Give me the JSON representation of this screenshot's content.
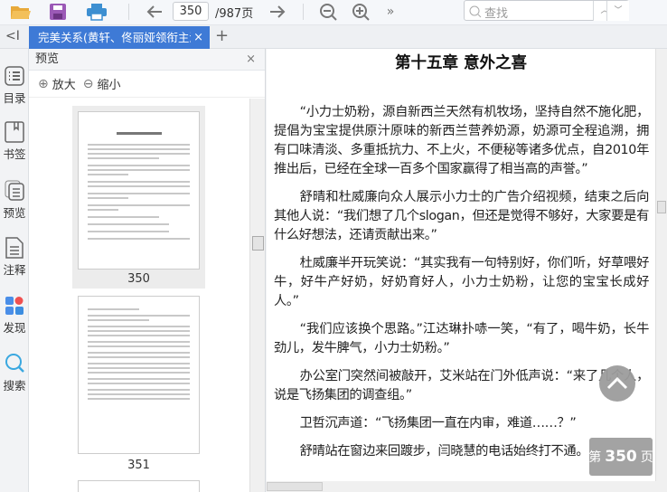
{
  "toolbar": {
    "current_page": "350",
    "total_pages": "/987页",
    "search_placeholder": "查找",
    "more": "»"
  },
  "tabs": [
    {
      "label": "完美关系(黄轩、佟丽娅领衔主演",
      "close": "×"
    }
  ],
  "tab_add": "+",
  "collapse": "<I",
  "leftbar": [
    "目录",
    "书签",
    "预览",
    "注释",
    "发现",
    "搜索"
  ],
  "preview": {
    "title": "预览",
    "close": "×",
    "zoom_in": "放大",
    "zoom_out": "缩小",
    "pages": [
      "350",
      "351"
    ]
  },
  "document": {
    "chapter_title": "第十五章  意外之喜",
    "paragraphs": [
      "“小力士奶粉，源自新西兰天然有机牧场，坚持自然不施化肥，提倡为宝宝提供原汁原味的新西兰营养奶源，奶源可全程追溯，拥有口味清淡、多重抵抗力、不上火，不便秘等诸多优点，自2010年推出后，已经在全球一百多个国家赢得了相当高的声誉。”",
      "舒晴和杜威廉向众人展示小力士的广告介绍视频，结束之后向其他人说：“我们想了几个slogan，但还是觉得不够好，大家要是有什么好想法，还请贡献出来。”",
      "杜威廉半开玩笑说：“其实我有一句特别好，你们听，好草喂好牛，好牛产好奶，好奶育好人，小力士奶粉，让您的宝宝长成好人。”",
      "“我们应该换个思路。”江达琳扑哧一笑，“有了，喝牛奶，长牛劲儿，发牛脾气，小力士奶粉。”",
      "办公室门突然间被敲开，艾米站在门外低声说：“来了几个人，说是飞扬集团的调查组。”",
      "卫哲沉声道：“飞扬集团一直在内审，难道……？”",
      "舒晴站在窗边来回踱步，闫晓慧的电话始终打不通。"
    ]
  },
  "page_badge": {
    "prefix": "第",
    "number": "350",
    "suffix": "页"
  }
}
